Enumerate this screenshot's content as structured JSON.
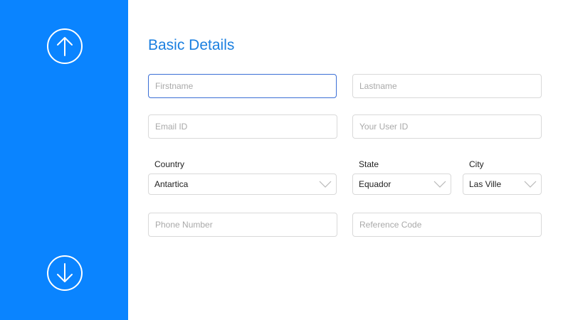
{
  "sidebar": {
    "up_icon": "arrow-up-circle-icon",
    "down_icon": "arrow-down-circle-icon",
    "color": "#0a84ff"
  },
  "form": {
    "title": "Basic Details",
    "firstname_placeholder": "Firstname",
    "lastname_placeholder": "Lastname",
    "email_placeholder": "Email ID",
    "userid_placeholder": "Your User ID",
    "country_label": "Country",
    "country_value": "Antartica",
    "state_label": "State",
    "state_value": "Equador",
    "city_label": "City",
    "city_value": "Las Ville",
    "phone_placeholder": "Phone Number",
    "reference_placeholder": "Reference Code",
    "accent_color": "#1a7fe0"
  }
}
